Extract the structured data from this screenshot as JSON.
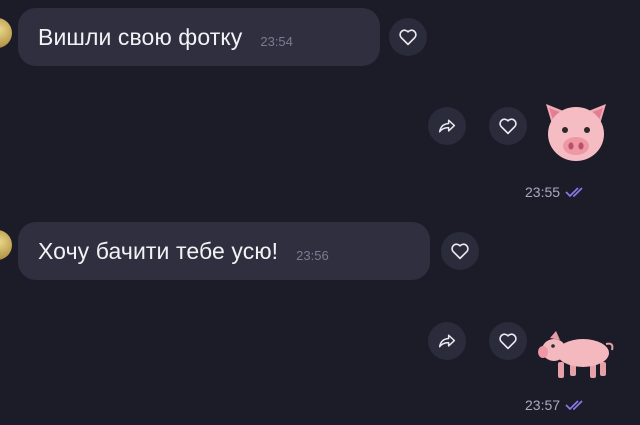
{
  "messages": [
    {
      "text": "Вишли свою фотку",
      "time": "23:54"
    },
    {
      "text": "Хочу бачити тебе усю!",
      "time": "23:56"
    }
  ],
  "stickers": [
    {
      "emoji": "pig-face",
      "time": "23:55"
    },
    {
      "emoji": "pig",
      "time": "23:57"
    }
  ],
  "icons": {
    "like": "heart-icon",
    "share": "forward-arrow-icon",
    "read": "double-check-icon"
  },
  "colors": {
    "background": "#1c1c29",
    "incoming_bubble": "#2f2f40",
    "read_check": "#8a7cf0"
  }
}
